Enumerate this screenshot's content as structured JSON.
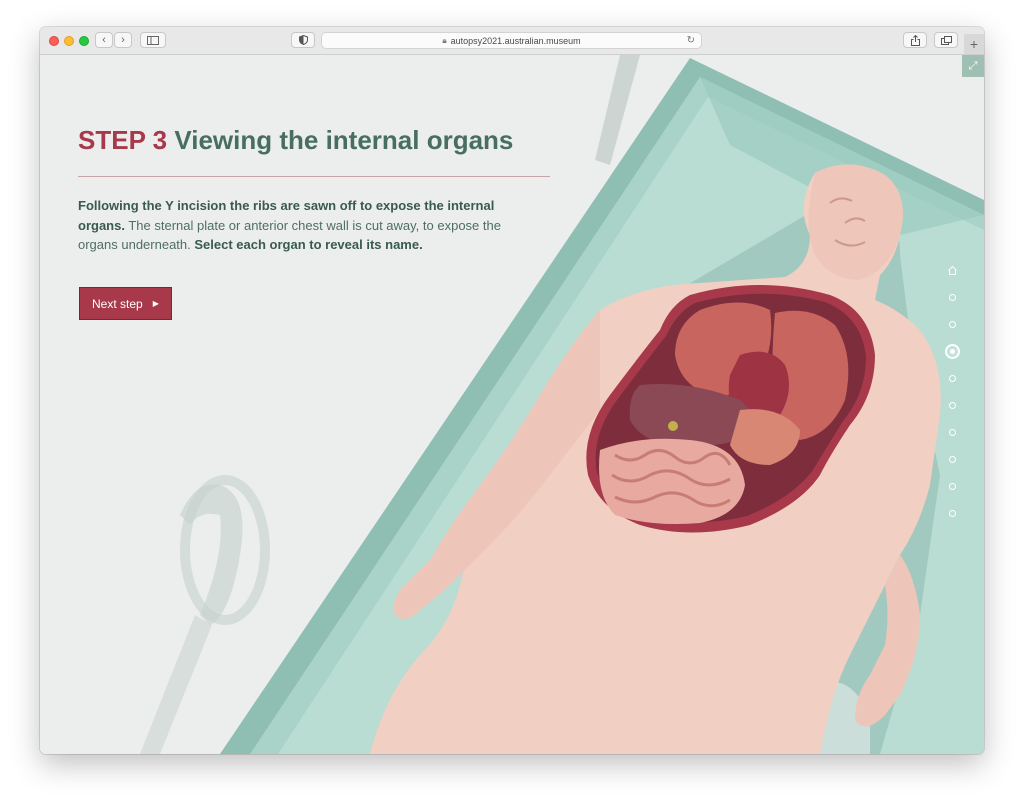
{
  "browser": {
    "url": "autopsy2021.australian.museum"
  },
  "page": {
    "step_label": "STEP 3",
    "title": "Viewing the internal organs",
    "intro_bold_1": "Following the Y incision the ribs are sawn off to expose the internal organs.",
    "intro_regular": " The sternal plate or anterior chest wall is cut away, to expose the organs underneath. ",
    "intro_bold_2": "Select each organ to reveal its name.",
    "next_button": "Next step"
  },
  "colors": {
    "accent": "#a8394a",
    "heading_green": "#486e62",
    "table_green": "#9cc9bd",
    "skin": "#f2cfc3"
  },
  "icons": {
    "next_arrow": "triangle-right",
    "expand": "expand-arrows",
    "home": "home"
  },
  "progress_nav": {
    "total": 10,
    "current_index": 3
  }
}
